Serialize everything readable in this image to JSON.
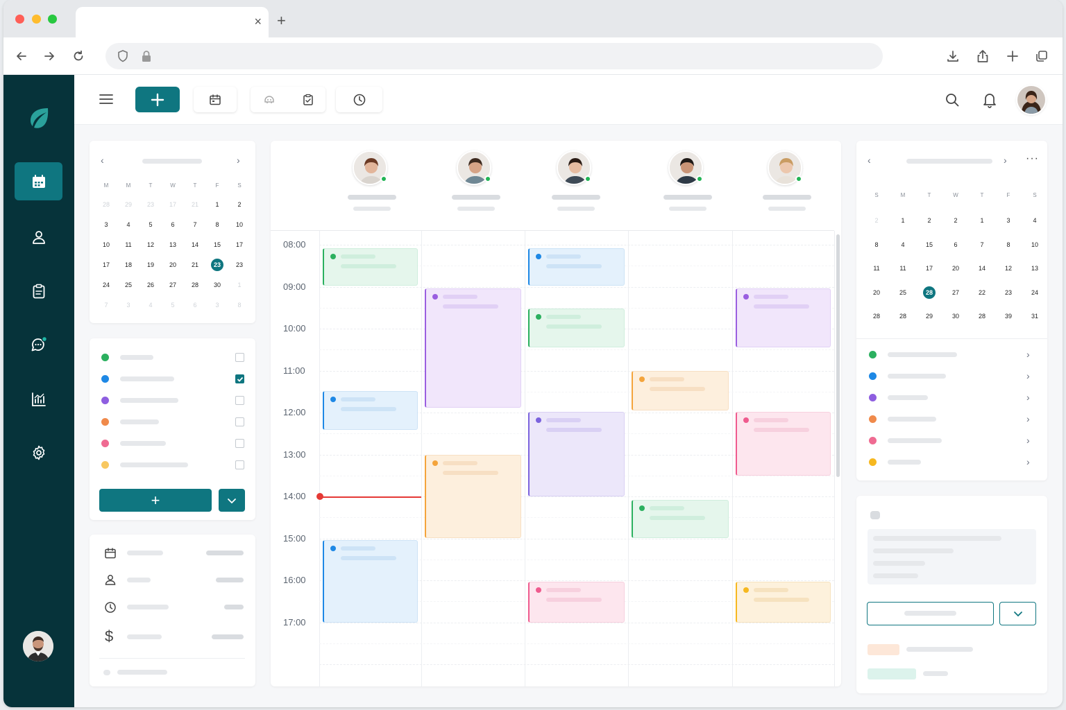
{
  "browser": {
    "close_glyph": "×",
    "newtab_glyph": "+"
  },
  "mini_calendar_left": {
    "weekdays": [
      "M",
      "M",
      "T",
      "W",
      "T",
      "F",
      "S"
    ],
    "weeks": [
      [
        {
          "d": "28",
          "m": true
        },
        {
          "d": "29",
          "m": true
        },
        {
          "d": "23",
          "m": true
        },
        {
          "d": "17",
          "m": true
        },
        {
          "d": "21",
          "m": true
        },
        {
          "d": "1"
        },
        {
          "d": "2"
        }
      ],
      [
        {
          "d": "3"
        },
        {
          "d": "4"
        },
        {
          "d": "5"
        },
        {
          "d": "6"
        },
        {
          "d": "7"
        },
        {
          "d": "8"
        },
        {
          "d": "10"
        }
      ],
      [
        {
          "d": "10"
        },
        {
          "d": "11"
        },
        {
          "d": "12"
        },
        {
          "d": "13"
        },
        {
          "d": "14"
        },
        {
          "d": "15"
        },
        {
          "d": "17"
        }
      ],
      [
        {
          "d": "17"
        },
        {
          "d": "18"
        },
        {
          "d": "19"
        },
        {
          "d": "20"
        },
        {
          "d": "21"
        },
        {
          "d": "23",
          "s": true
        },
        {
          "d": "23"
        }
      ],
      [
        {
          "d": "24"
        },
        {
          "d": "25"
        },
        {
          "d": "26"
        },
        {
          "d": "27"
        },
        {
          "d": "28"
        },
        {
          "d": "30"
        },
        {
          "d": "1",
          "m": true
        }
      ],
      [
        {
          "d": "7",
          "m": true
        },
        {
          "d": "3",
          "m": true
        },
        {
          "d": "4",
          "m": true
        },
        {
          "d": "5",
          "m": true
        },
        {
          "d": "6",
          "m": true
        },
        {
          "d": "3",
          "m": true
        },
        {
          "d": "8",
          "m": true
        }
      ]
    ]
  },
  "mini_calendar_right": {
    "weekdays": [
      "S",
      "M",
      "T",
      "W",
      "T",
      "F",
      "S"
    ],
    "weeks": [
      [
        {
          "d": "2",
          "m": true
        },
        {
          "d": "1"
        },
        {
          "d": "2"
        },
        {
          "d": "2"
        },
        {
          "d": "1"
        },
        {
          "d": "3"
        },
        {
          "d": "4"
        }
      ],
      [
        {
          "d": "8"
        },
        {
          "d": "4"
        },
        {
          "d": "15"
        },
        {
          "d": "6"
        },
        {
          "d": "7"
        },
        {
          "d": "8"
        },
        {
          "d": "10"
        }
      ],
      [
        {
          "d": "11"
        },
        {
          "d": "11"
        },
        {
          "d": "17"
        },
        {
          "d": "20"
        },
        {
          "d": "14"
        },
        {
          "d": "12"
        },
        {
          "d": "13"
        }
      ],
      [
        {
          "d": "20"
        },
        {
          "d": "25"
        },
        {
          "d": "28",
          "s": true
        },
        {
          "d": "27"
        },
        {
          "d": "22"
        },
        {
          "d": "23"
        },
        {
          "d": "24"
        }
      ],
      [
        {
          "d": "28"
        },
        {
          "d": "28"
        },
        {
          "d": "29"
        },
        {
          "d": "30"
        },
        {
          "d": "28"
        },
        {
          "d": "39"
        },
        {
          "d": "31"
        }
      ]
    ]
  },
  "calendar_filters": [
    {
      "color": "#2bb05f",
      "checked": false
    },
    {
      "color": "#1e88e5",
      "checked": true
    },
    {
      "color": "#8e5ee0",
      "checked": false
    },
    {
      "color": "#f08a4b",
      "checked": false
    },
    {
      "color": "#ef6b92",
      "checked": false
    },
    {
      "color": "#f8c860",
      "checked": false
    }
  ],
  "add_button_glyph": "+",
  "right_list_colors": [
    "#2bb05f",
    "#1e88e5",
    "#8e5ee0",
    "#f08a4b",
    "#ef6b92",
    "#f6b820"
  ],
  "schedule": {
    "times": [
      "08:00",
      "09:00",
      "10:00",
      "11:00",
      "12:00",
      "13:00",
      "14:00",
      "15:00",
      "16:00",
      "17:00"
    ]
  },
  "colors": {
    "primary": "#0f7680",
    "rail": "#06333a",
    "now_line": "#e53935"
  }
}
